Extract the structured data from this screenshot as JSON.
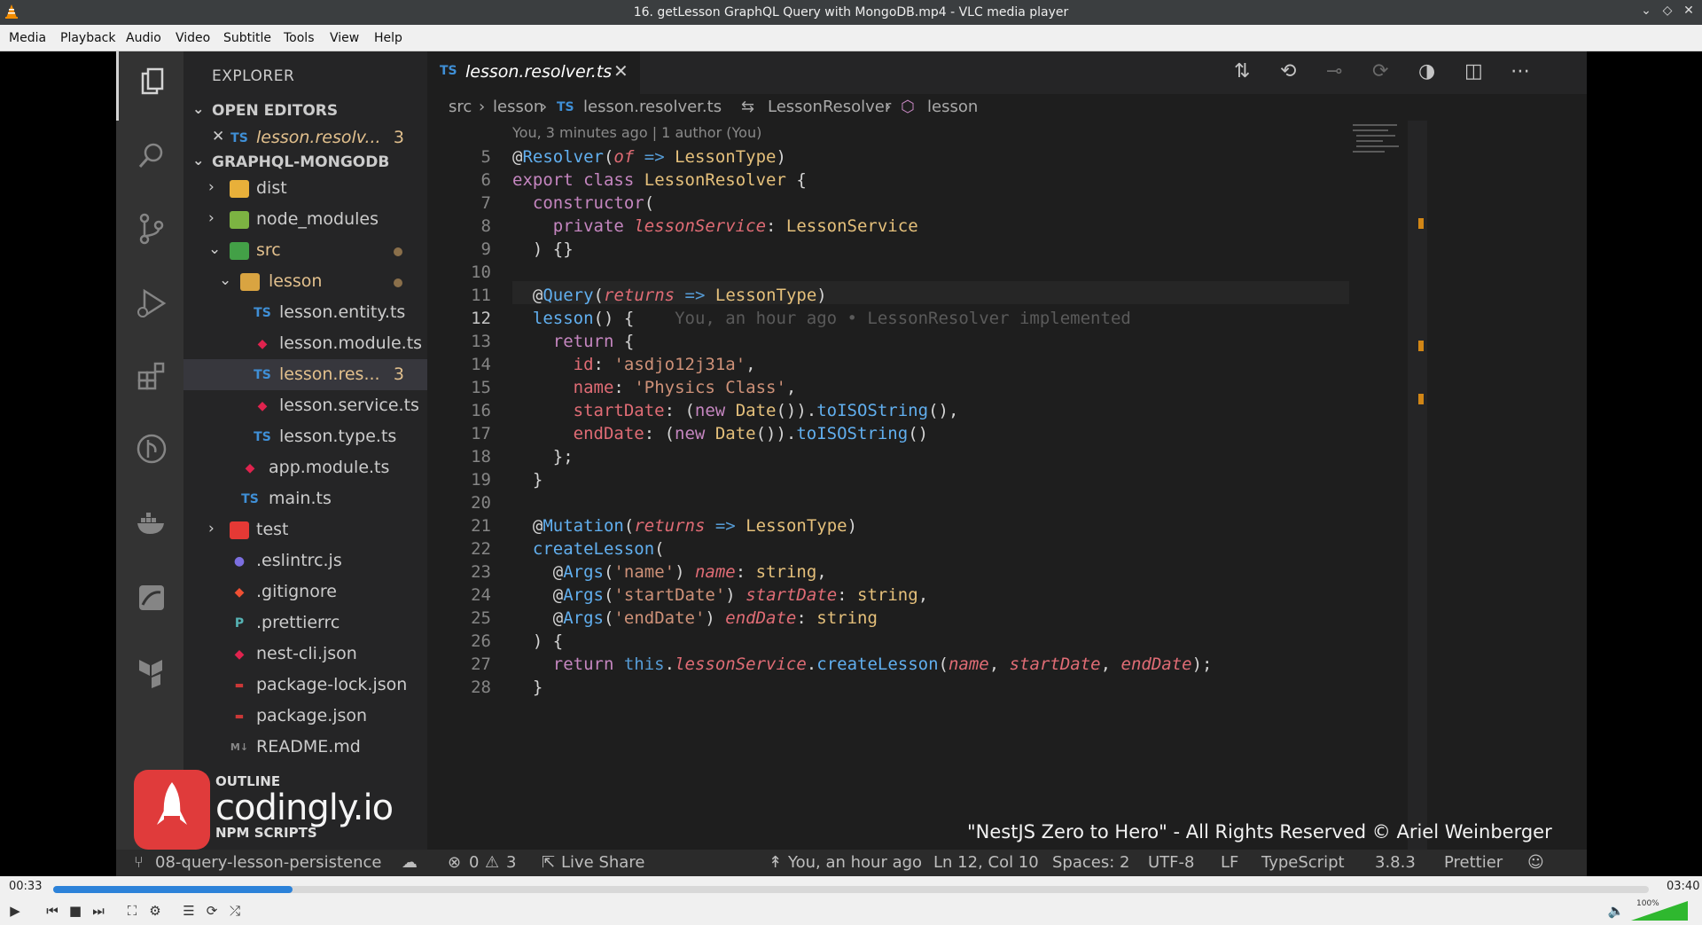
{
  "window": {
    "title": "16. getLesson GraphQL Query with MongoDB.mp4 - VLC media player"
  },
  "menu": [
    "Media",
    "Playback",
    "Audio",
    "Video",
    "Subtitle",
    "Tools",
    "View",
    "Help"
  ],
  "explorer": {
    "header": "EXPLORER",
    "open_editors_label": "OPEN EDITORS",
    "open_editor": {
      "name": "lesson.resolv...",
      "badge": "3"
    },
    "project_label": "GRAPHQL-MONGODB",
    "tree": [
      {
        "name": "dist",
        "icon": "folder-dist-icon"
      },
      {
        "name": "node_modules",
        "icon": "folder-node-icon"
      },
      {
        "name": "src",
        "icon": "folder-src-icon"
      },
      {
        "name": "lesson",
        "icon": "folder-icon"
      },
      {
        "name": "lesson.entity.ts",
        "icon": "ts-icon"
      },
      {
        "name": "lesson.module.ts",
        "icon": "nest-icon"
      },
      {
        "name": "lesson.res...",
        "icon": "ts-icon",
        "badge": "3"
      },
      {
        "name": "lesson.service.ts",
        "icon": "nest-icon"
      },
      {
        "name": "lesson.type.ts",
        "icon": "ts-icon"
      },
      {
        "name": "app.module.ts",
        "icon": "nest-icon"
      },
      {
        "name": "main.ts",
        "icon": "ts-icon"
      },
      {
        "name": "test",
        "icon": "folder-test-icon"
      },
      {
        "name": ".eslintrc.js",
        "icon": "eslint-icon"
      },
      {
        "name": ".gitignore",
        "icon": "git-icon"
      },
      {
        "name": ".prettierrc",
        "icon": "prettier-icon"
      },
      {
        "name": "nest-cli.json",
        "icon": "nest-icon"
      },
      {
        "name": "package-lock.json",
        "icon": "npm-icon"
      },
      {
        "name": "package.json",
        "icon": "npm-icon"
      },
      {
        "name": "README.md",
        "icon": "markdown-icon"
      }
    ],
    "outline_label": "OUTLINE",
    "npm_scripts_label": "NPM SCRIPTS"
  },
  "editor": {
    "tab": {
      "icon_text": "TS",
      "name": "lesson.resolver.ts"
    },
    "breadcrumb": [
      "src",
      "lesson",
      "TS",
      "lesson.resolver.ts",
      "LessonResolver",
      "lesson"
    ],
    "codelens": "You, 3 minutes ago | 1 author (You)",
    "blame": "You, an hour ago • LessonResolver implemented",
    "line_numbers": [
      "5",
      "6",
      "7",
      "8",
      "9",
      "10",
      "11",
      "12",
      "13",
      "14",
      "15",
      "16",
      "17",
      "18",
      "19",
      "20",
      "21",
      "22",
      "23",
      "24",
      "25",
      "26",
      "27",
      "28"
    ]
  },
  "status": {
    "branch": "08-query-lesson-persistence",
    "errors": "0",
    "warnings": "3",
    "live_share": "Live Share",
    "blame": "You, an hour ago",
    "position": "Ln 12, Col 10",
    "spaces": "Spaces: 2",
    "encoding": "UTF-8",
    "eol": "LF",
    "language": "TypeScript",
    "version": "3.8.3",
    "formatter": "Prettier"
  },
  "overlay": {
    "watermark": "\"NestJS Zero to Hero\" - All Rights Reserved © Ariel Weinberger",
    "logo_text": "codingly.io"
  },
  "player": {
    "elapsed": "00:33",
    "total": "03:40",
    "progress": 0.15,
    "volume_label": "100%",
    "colors": {
      "seek": "#2c82d9",
      "accent": "#f28c00"
    }
  }
}
